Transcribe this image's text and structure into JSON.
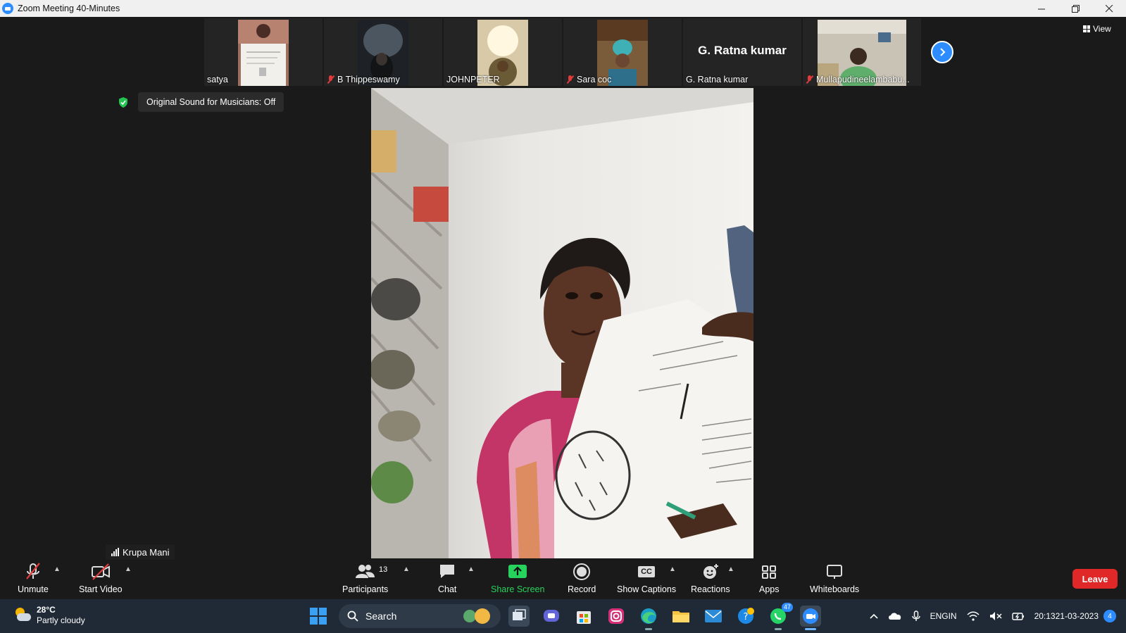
{
  "window": {
    "title": "Zoom Meeting 40-Minutes"
  },
  "gallery": {
    "tiles": [
      {
        "name": "satya",
        "muted": false
      },
      {
        "name": "B Thippeswamy",
        "muted": true
      },
      {
        "name": "JOHNPETER",
        "muted": false
      },
      {
        "name": "Sara coc",
        "muted": true
      },
      {
        "name": "G. Ratna kumar",
        "big_name": "G. Ratna kumar",
        "muted": false
      },
      {
        "name": "Mullapudineelambabu...",
        "muted": true
      }
    ],
    "view_label": "View"
  },
  "banner": {
    "original_sound": "Original Sound for Musicians: Off"
  },
  "active_speaker": {
    "name": "Krupa Mani"
  },
  "toolbar": {
    "unmute": "Unmute",
    "start_video": "Start Video",
    "participants": "Participants",
    "participants_count": "13",
    "chat": "Chat",
    "share_screen": "Share Screen",
    "record": "Record",
    "show_captions": "Show Captions",
    "captions_icon_text": "CC",
    "reactions": "Reactions",
    "apps": "Apps",
    "whiteboards": "Whiteboards",
    "leave": "Leave"
  },
  "taskbar": {
    "weather_temp": "28°C",
    "weather_cond": "Partly cloudy",
    "search_label": "Search",
    "whatsapp_badge": "47",
    "lang_top": "ENG",
    "lang_bottom": "IN",
    "time": "20:13",
    "date": "21-03-2023",
    "notification_count": "4"
  },
  "colors": {
    "zoom_blue": "#2d8cff",
    "leave_red": "#e02828",
    "share_green": "#26d35c",
    "muted_red": "#e23b3b",
    "background": "#1a1a1a"
  }
}
